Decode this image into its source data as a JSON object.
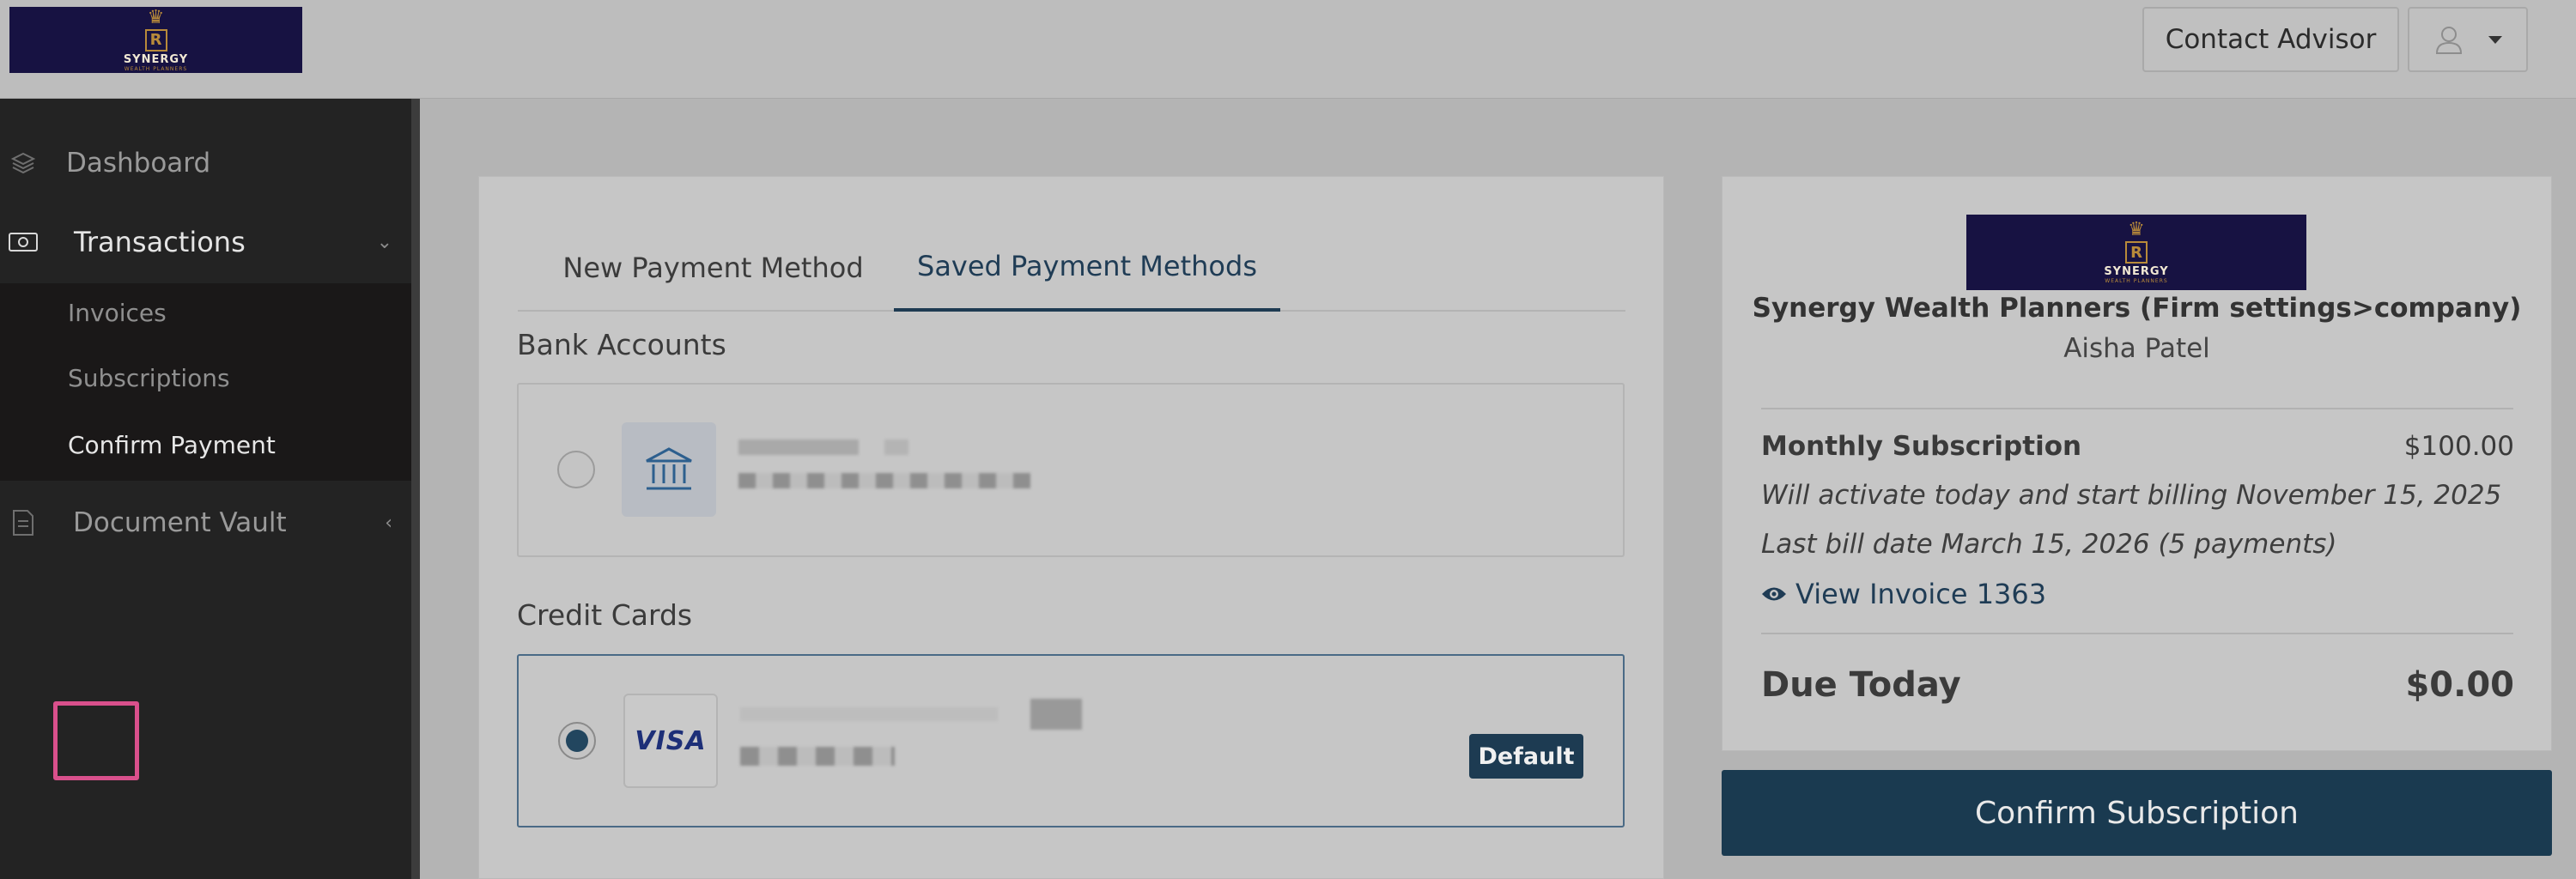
{
  "header": {
    "logo": {
      "word": "SYNERGY",
      "sub": "WEALTH PLANNERS",
      "monogram": "R"
    },
    "contact_advisor_label": "Contact Advisor",
    "user_menu_icon": "user-icon"
  },
  "sidebar": {
    "items": [
      {
        "label": "Dashboard",
        "icon": "layers-icon"
      },
      {
        "label": "Transactions",
        "icon": "cash-icon"
      },
      {
        "label": "Document Vault",
        "icon": "document-icon"
      }
    ],
    "sub_items": [
      {
        "label": "Invoices"
      },
      {
        "label": "Subscriptions"
      },
      {
        "label": "Confirm Payment",
        "active": true
      }
    ]
  },
  "payment": {
    "tabs": [
      {
        "label": "New Payment Method"
      },
      {
        "label": "Saved Payment Methods",
        "active": true
      }
    ],
    "bank_section_title": "Bank Accounts",
    "card_section_title": "Credit Cards",
    "card_brand": "VISA",
    "default_badge": "Default"
  },
  "summary": {
    "logo": {
      "word": "SYNERGY",
      "sub": "WEALTH PLANNERS",
      "monogram": "R"
    },
    "firm_name": "Synergy Wealth Planners (Firm settings>company)",
    "client_name": "Aisha Patel",
    "subscription_label": "Monthly Subscription",
    "subscription_amount": "$100.00",
    "note_activate": "Will activate today and start billing November 15, 2025",
    "note_last_bill": "Last bill date March 15, 2026 (5 payments)",
    "invoice_link": "View Invoice 1363",
    "due_label": "Due Today",
    "due_amount": "$0.00",
    "confirm_button": "Confirm Subscription"
  },
  "colors": {
    "accent": "#1a3a50",
    "highlight": "#d9508c",
    "sidebar_bg": "#232323"
  }
}
